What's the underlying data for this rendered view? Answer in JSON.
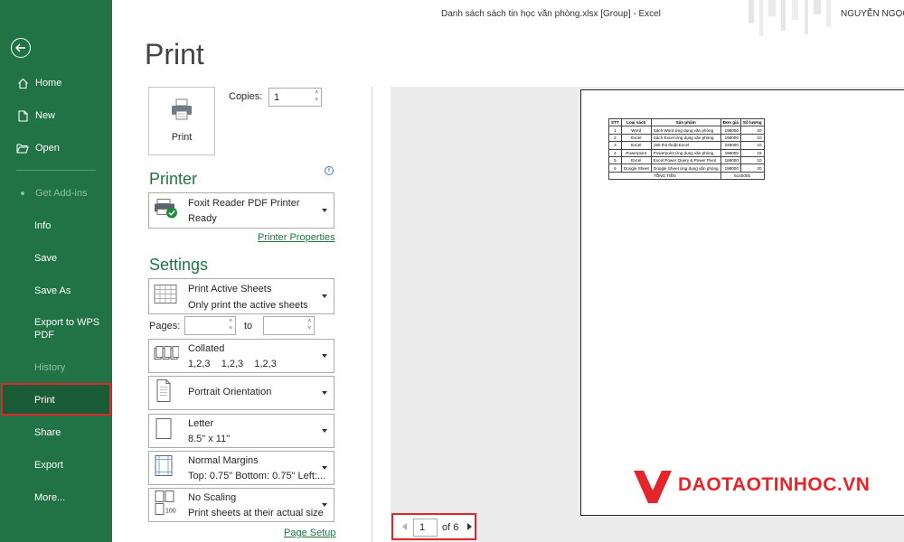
{
  "titlebar": {
    "doc": "Danh sách sách tin học văn phòng.xlsx  [Group]  -  Excel",
    "user": "NGUYỄN NGỌC"
  },
  "sidebar": {
    "home": "Home",
    "new": "New",
    "open": "Open",
    "addins": "Get Add-ins",
    "info": "Info",
    "save": "Save",
    "saveas": "Save As",
    "wps1": "Export to WPS",
    "wps2": "PDF",
    "history": "History",
    "print": "Print",
    "share": "Share",
    "export": "Export",
    "more": "More..."
  },
  "main": {
    "title": "Print",
    "print_button": "Print",
    "copies_label": "Copies:",
    "copies_value": "1",
    "printer_heading": "Printer",
    "printer_name": "Foxit Reader PDF Printer",
    "printer_status": "Ready",
    "printer_properties": "Printer Properties",
    "settings_heading": "Settings",
    "pages_label": "Pages:",
    "to_label": "to",
    "page_setup": "Page Setup"
  },
  "settings": {
    "what": {
      "l1": "Print Active Sheets",
      "l2": "Only print the active sheets"
    },
    "collate": {
      "l1": "Collated",
      "l2": "1,2,3    1,2,3    1,2,3"
    },
    "orientation": {
      "l1": "Portrait Orientation"
    },
    "paper": {
      "l1": "Letter",
      "l2": "8.5\" x 11\""
    },
    "margins": {
      "l1": "Normal Margins",
      "l2": "Top: 0.75\" Bottom: 0.75\" Left:..."
    },
    "scaling": {
      "l1": "No Scaling",
      "l2": "Print sheets at their actual size"
    }
  },
  "preview": {
    "headers": [
      "STT",
      "Loại sách",
      "Sản phẩm",
      "Đơn giá",
      "Số lượng"
    ],
    "rows": [
      [
        "1",
        "Word",
        "Sách Word ứng dụng văn phòng",
        "198000",
        "20"
      ],
      [
        "2",
        "Excel",
        "Sách Excel ứng dụng văn phòng",
        "198000",
        "10"
      ],
      [
        "3",
        "Excel",
        "150 thủ thuật Excel",
        "228000",
        "10"
      ],
      [
        "4",
        "Powerpoint",
        "Powerpoint ứng dụng văn phòng",
        "198000",
        "15"
      ],
      [
        "5",
        "Excel",
        "Excel Power Query & Power Pivot",
        "188000",
        "10"
      ],
      [
        "6",
        "Google Sheet",
        "Google Sheet ứng dụng văn phòng",
        "198000",
        "20"
      ]
    ],
    "total_label": "TỔNG TIỀN",
    "total_value": "6140000",
    "logo": "DAOTAOTINHOC.VN",
    "logo_colors": {
      "primary": "#e4262b"
    }
  },
  "pager": {
    "current": "1",
    "of": "of 6"
  },
  "colors": {
    "sidebar": "#217346",
    "accent_green": "#217346",
    "highlight_border": "#e0262b"
  }
}
